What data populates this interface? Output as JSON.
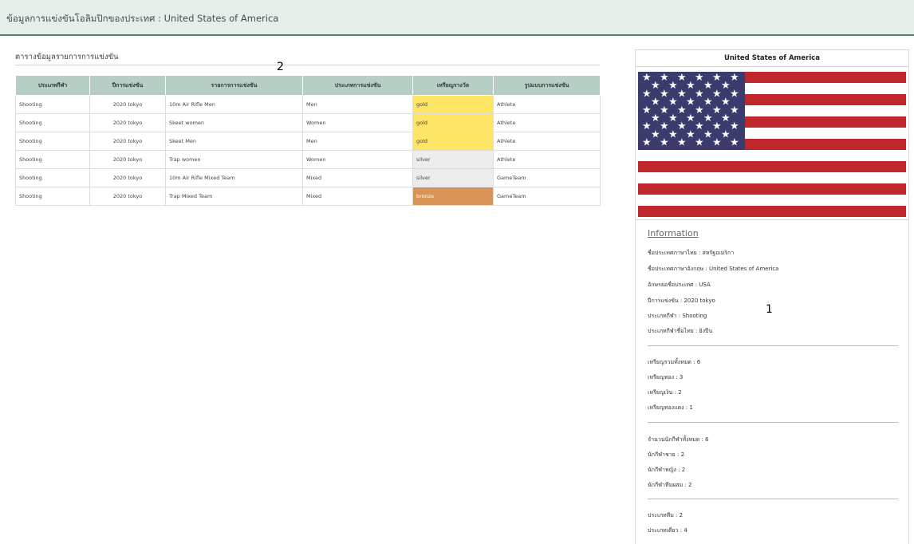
{
  "header": {
    "title": "ข้อมูลการแข่งขันโอลิมปิกของประเทศ : United States of America"
  },
  "markers": {
    "one": "1",
    "two": "2"
  },
  "table": {
    "heading": "ตารางข้อมูลรายการการแข่งขัน",
    "columns": [
      "ประเภทกีฬา",
      "ปีการแข่งขัน",
      "รายการการแข่งขัน",
      "ประเภทการแข่งขัน",
      "เหรียญรางวัล",
      "รูปแบบการแข่งขัน"
    ],
    "rows": [
      {
        "sport": "Shooting",
        "year": "2020 tokyo",
        "event": "10m Air Rifle Men",
        "category": "Men",
        "medal": "gold",
        "format": "Athlete"
      },
      {
        "sport": "Shooting",
        "year": "2020 tokyo",
        "event": "Skeet women",
        "category": "Women",
        "medal": "gold",
        "format": "Athlete"
      },
      {
        "sport": "Shooting",
        "year": "2020 tokyo",
        "event": "Skeet Men",
        "category": "Men",
        "medal": "gold",
        "format": "Athlete"
      },
      {
        "sport": "Shooting",
        "year": "2020 tokyo",
        "event": "Trap women",
        "category": "Women",
        "medal": "silver",
        "format": "Athlete"
      },
      {
        "sport": "Shooting",
        "year": "2020 tokyo",
        "event": "10m Air Rifle Mixed Team",
        "category": "Mixed",
        "medal": "silver",
        "format": "GameTeam"
      },
      {
        "sport": "Shooting",
        "year": "2020 tokyo",
        "event": "Trap Mixed Team",
        "category": "Mixed",
        "medal": "bronze",
        "format": "GameTeam"
      }
    ]
  },
  "medal_colors": {
    "gold": "#ffe566",
    "silver": "#ececec",
    "bronze": "#d89456"
  },
  "panel": {
    "country": "United States of America",
    "flag_icon": "us-flag",
    "info_title": "Information",
    "lines": [
      "ชื่อประเทศภาษาไทย : สหรัฐอเมริกา",
      "ชื่อประเทศภาษาอังกฤษ : United States of America",
      "อักษรย่อชื่อประเทศ : USA",
      "ปีการแข่งขัน : 2020 tokyo",
      "ประเภทกีฬา : Shooting",
      "ประเภทกีฬาชื่อไทย : ยิงปืน"
    ],
    "medals": [
      "เหรียญรวมทั้งหมด : 6",
      "เหรียญทอง : 3",
      "เหรียญเงิน : 2",
      "เหรียญทองแดง : 1"
    ],
    "athletes": [
      "จำนวนนักกีฬาทั้งหมด : 6",
      "นักกีฬาชาย : 2",
      "นักกีฬาหญิง : 2",
      "นักกีฬาทีมผสม : 2"
    ],
    "types": [
      "ประเภททีม : 2",
      "ประเภทเดี่ยว : 4"
    ]
  }
}
